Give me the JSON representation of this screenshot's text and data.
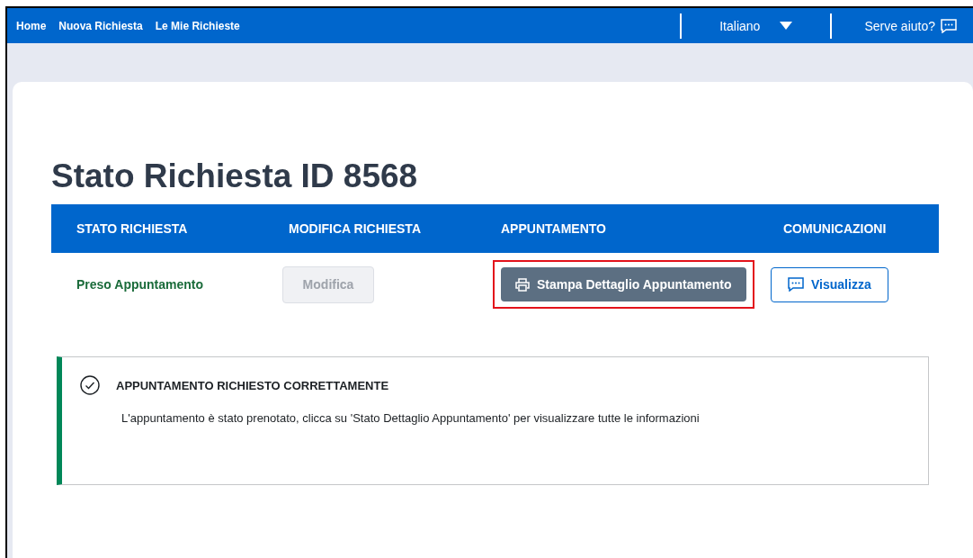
{
  "nav": {
    "links": [
      {
        "label": "Home"
      },
      {
        "label": "Nuova Richiesta"
      },
      {
        "label": "Le Mie Richieste"
      }
    ],
    "language": "Italiano",
    "help": "Serve aiuto?"
  },
  "title": "Stato Richiesta ID 8568",
  "table": {
    "columns": [
      "STATO RICHIESTA",
      "MODIFICA RICHIESTA",
      "APPUNTAMENTO",
      "COMUNICAZIONI"
    ],
    "row": {
      "status": "Preso Appuntamento",
      "edit_button": {
        "label": "Modifica",
        "disabled": true
      },
      "print_button": {
        "label": "Stampa Dettaglio Appuntamento",
        "highlighted": true
      },
      "view_button": {
        "label": "Visualizza"
      }
    }
  },
  "alert": {
    "kind": "success",
    "title": "APPUNTAMENTO RICHIESTO CORRETTAMENTE",
    "message": "L'appuntamento è stato prenotato, clicca su 'Stato Dettaglio Appuntamento' per visualizzare tutte le informazioni"
  }
}
